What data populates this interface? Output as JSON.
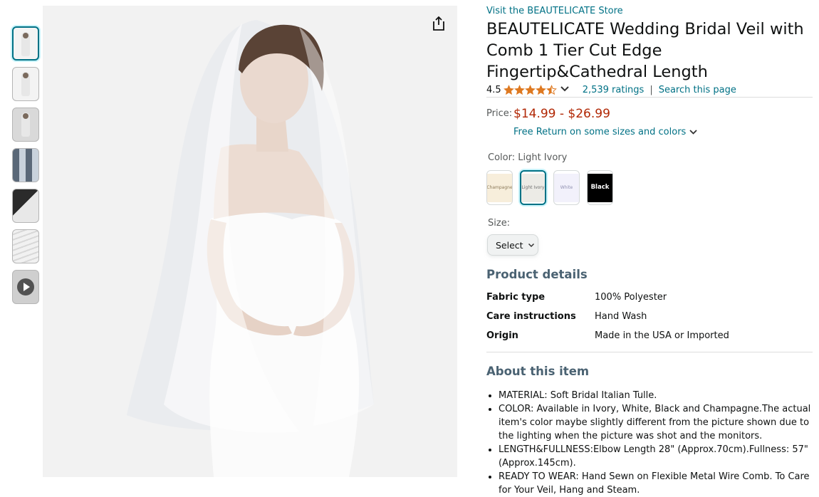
{
  "thumbnails": [
    {
      "label": "thumbnail-1",
      "selected": true
    },
    {
      "label": "thumbnail-2",
      "selected": false
    },
    {
      "label": "thumbnail-3",
      "selected": false
    },
    {
      "label": "thumbnail-4",
      "selected": false
    },
    {
      "label": "thumbnail-5",
      "selected": false
    },
    {
      "label": "thumbnail-6",
      "selected": false
    },
    {
      "label": "thumbnail-7-video",
      "selected": false
    }
  ],
  "product": {
    "store_link": "Visit the BEAUTELICATE Store",
    "title": "BEAUTELICATE Wedding Bridal Veil with Comb 1 Tier Cut Edge Fingertip&Cathedral Length",
    "rating": "4.5",
    "rating_stars": 4.5,
    "ratings_count": "2,539 ratings",
    "separator": "|",
    "search_link": "Search this page",
    "price_label": "Price:",
    "price": "$14.99 - $26.99",
    "free_return": "Free Return on some sizes and colors",
    "color_label": "Color: Light Ivory",
    "swatches": [
      {
        "label": "Champagne",
        "color": "#f7eedb"
      },
      {
        "label": "Light Ivory",
        "color": "#ecebe6"
      },
      {
        "label": "White",
        "color": "#f2f1fb"
      },
      {
        "label": "Black",
        "color": "#000000"
      }
    ],
    "size_label": "Size:",
    "size_select": "Select"
  },
  "details": {
    "heading": "Product details",
    "rows": [
      {
        "key": "Fabric type",
        "value": "100% Polyester"
      },
      {
        "key": "Care instructions",
        "value": "Hand Wash"
      },
      {
        "key": "Origin",
        "value": "Made in the USA or Imported"
      }
    ]
  },
  "about": {
    "heading": "About this item",
    "bullets": [
      "MATERIAL: Soft Bridal Italian Tulle.",
      "COLOR: Available in Ivory, White, Black and Champagne.The actual item's color maybe slightly different from the picture shown due to the lighting when the picture was shot and the monitors.",
      "LENGTH&FULLNESS:Elbow Length 28\" (Approx.70cm).Fullness: 57\" (Approx.145cm).",
      "READY TO WEAR: Hand Sewn on Flexible Metal Wire Comb. To Care for Your Veil, Hang and Steam."
    ]
  },
  "colors": {
    "link": "#007185",
    "price": "#b12704",
    "star": "#de7921",
    "section_heading": "#4a6272"
  },
  "icons": [
    "share-icon",
    "star-icon",
    "chevron-down-icon",
    "play-icon"
  ]
}
